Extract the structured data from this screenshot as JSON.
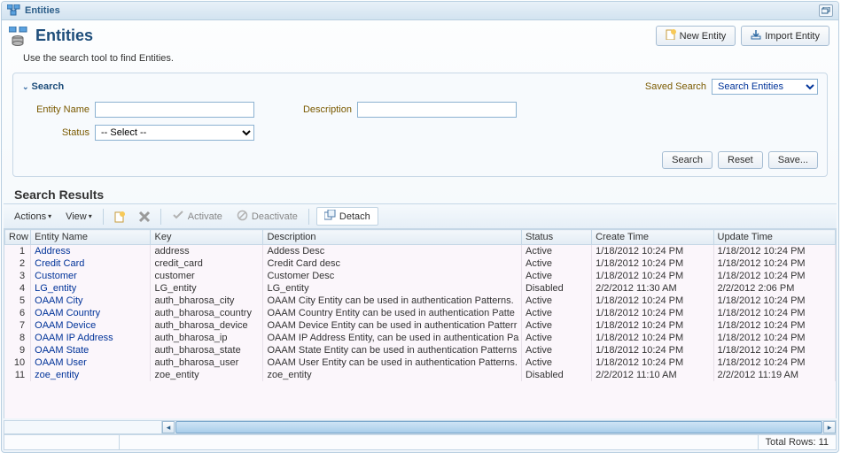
{
  "tab": {
    "label": "Entities"
  },
  "page": {
    "title": "Entities",
    "helper": "Use the search tool to find Entities."
  },
  "header_buttons": {
    "new_entity": "New Entity",
    "import_entity": "Import Entity"
  },
  "search": {
    "title": "Search",
    "saved_search_label": "Saved Search",
    "saved_search_selected": "Search Entities",
    "fields": {
      "entity_name_label": "Entity Name",
      "entity_name_value": "",
      "description_label": "Description",
      "description_value": "",
      "status_label": "Status",
      "status_selected": "-- Select --"
    },
    "buttons": {
      "search": "Search",
      "reset": "Reset",
      "save": "Save..."
    }
  },
  "results": {
    "title": "Search Results",
    "toolbar": {
      "actions": "Actions",
      "view": "View",
      "activate": "Activate",
      "deactivate": "Deactivate",
      "detach": "Detach"
    },
    "columns": {
      "row": "Row",
      "name": "Entity Name",
      "key": "Key",
      "description": "Description",
      "status": "Status",
      "create_time": "Create Time",
      "update_time": "Update Time"
    },
    "rows": [
      {
        "n": "1",
        "name": "Address",
        "key": "address",
        "desc": "Addess Desc",
        "status": "Active",
        "create": "1/18/2012 10:24 PM",
        "update": "1/18/2012 10:24 PM"
      },
      {
        "n": "2",
        "name": "Credit Card",
        "key": "credit_card",
        "desc": "Credit Card desc",
        "status": "Active",
        "create": "1/18/2012 10:24 PM",
        "update": "1/18/2012 10:24 PM"
      },
      {
        "n": "3",
        "name": "Customer",
        "key": "customer",
        "desc": "Customer Desc",
        "status": "Active",
        "create": "1/18/2012 10:24 PM",
        "update": "1/18/2012 10:24 PM"
      },
      {
        "n": "4",
        "name": "LG_entity",
        "key": "LG_entity",
        "desc": "LG_entity",
        "status": "Disabled",
        "create": "2/2/2012 11:30 AM",
        "update": "2/2/2012 2:06 PM"
      },
      {
        "n": "5",
        "name": "OAAM City",
        "key": "auth_bharosa_city",
        "desc": "OAAM City Entity can be used in authentication Patterns.",
        "status": "Active",
        "create": "1/18/2012 10:24 PM",
        "update": "1/18/2012 10:24 PM"
      },
      {
        "n": "6",
        "name": "OAAM Country",
        "key": "auth_bharosa_country",
        "desc": "OAAM Country Entity can be used in authentication Patte",
        "status": "Active",
        "create": "1/18/2012 10:24 PM",
        "update": "1/18/2012 10:24 PM"
      },
      {
        "n": "7",
        "name": "OAAM Device",
        "key": "auth_bharosa_device",
        "desc": "OAAM Device Entity can be used in authentication Patterr",
        "status": "Active",
        "create": "1/18/2012 10:24 PM",
        "update": "1/18/2012 10:24 PM"
      },
      {
        "n": "8",
        "name": "OAAM IP Address",
        "key": "auth_bharosa_ip",
        "desc": "OAAM IP Address Entity, can be used in authentication Pa",
        "status": "Active",
        "create": "1/18/2012 10:24 PM",
        "update": "1/18/2012 10:24 PM"
      },
      {
        "n": "9",
        "name": "OAAM State",
        "key": "auth_bharosa_state",
        "desc": "OAAM State Entity can be used in authentication Patterns",
        "status": "Active",
        "create": "1/18/2012 10:24 PM",
        "update": "1/18/2012 10:24 PM"
      },
      {
        "n": "10",
        "name": "OAAM User",
        "key": "auth_bharosa_user",
        "desc": "OAAM User Entity can be used in authentication Patterns.",
        "status": "Active",
        "create": "1/18/2012 10:24 PM",
        "update": "1/18/2012 10:24 PM"
      },
      {
        "n": "11",
        "name": "zoe_entity",
        "key": "zoe_entity",
        "desc": "zoe_entity",
        "status": "Disabled",
        "create": "2/2/2012 11:10 AM",
        "update": "2/2/2012 11:19 AM"
      }
    ],
    "total_label": "Total Rows: 11"
  }
}
